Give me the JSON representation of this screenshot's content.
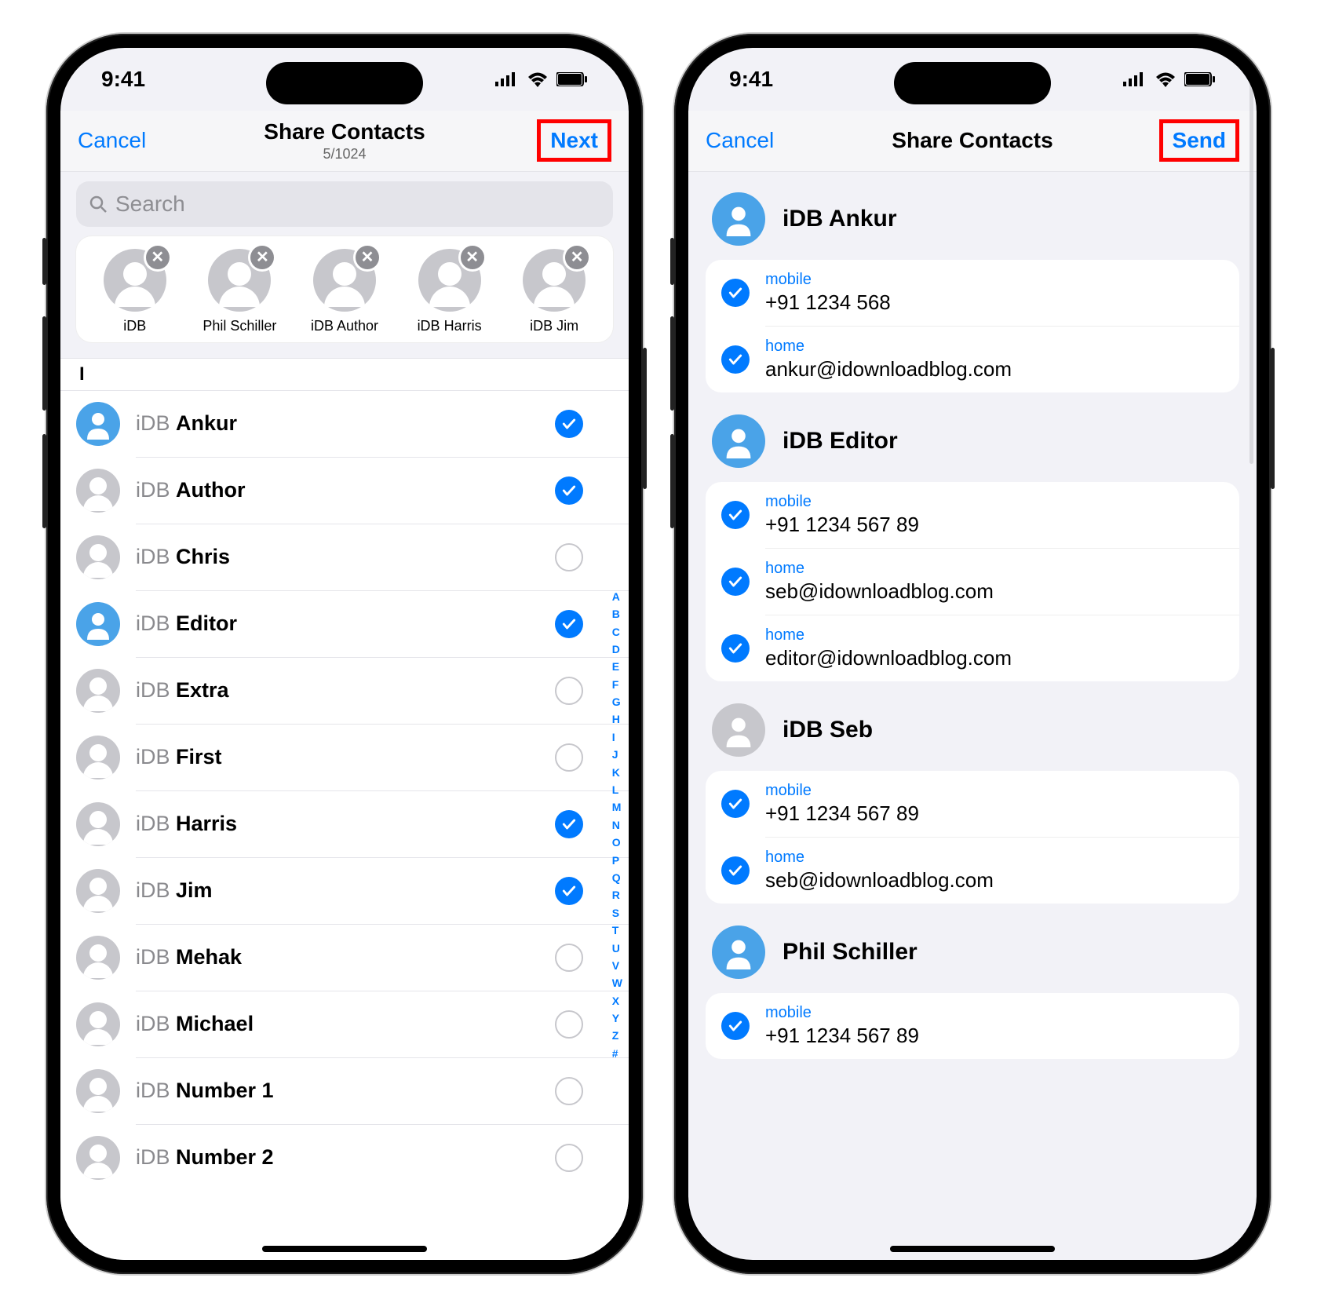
{
  "status_time": "9:41",
  "s1": {
    "cancel": "Cancel",
    "title": "Share Contacts",
    "subtitle": "5/1024",
    "next": "Next",
    "search_placeholder": "Search",
    "chips": [
      {
        "label": "iDB"
      },
      {
        "label": "Phil Schiller"
      },
      {
        "label": "iDB Author"
      },
      {
        "label": "iDB Harris"
      },
      {
        "label": "iDB Jim"
      }
    ],
    "section": "I",
    "rows": [
      {
        "first": "iDB",
        "last": "Ankur",
        "checked": true,
        "photo": true
      },
      {
        "first": "iDB",
        "last": "Author",
        "checked": true,
        "photo": false
      },
      {
        "first": "iDB",
        "last": "Chris",
        "checked": false,
        "photo": false
      },
      {
        "first": "iDB",
        "last": "Editor",
        "checked": true,
        "photo": true
      },
      {
        "first": "iDB",
        "last": "Extra",
        "checked": false,
        "photo": false
      },
      {
        "first": "iDB",
        "last": "First",
        "checked": false,
        "photo": false
      },
      {
        "first": "iDB",
        "last": "Harris",
        "checked": true,
        "photo": false
      },
      {
        "first": "iDB",
        "last": "Jim",
        "checked": true,
        "photo": false
      },
      {
        "first": "iDB",
        "last": "Mehak",
        "checked": false,
        "photo": false
      },
      {
        "first": "iDB",
        "last": "Michael",
        "checked": false,
        "photo": false
      },
      {
        "first": "iDB",
        "last": "Number 1",
        "checked": false,
        "photo": false
      },
      {
        "first": "iDB",
        "last": "Number 2",
        "checked": false,
        "photo": false
      }
    ],
    "az": [
      "A",
      "B",
      "C",
      "D",
      "E",
      "F",
      "G",
      "H",
      "I",
      "J",
      "K",
      "L",
      "M",
      "N",
      "O",
      "P",
      "Q",
      "R",
      "S",
      "T",
      "U",
      "V",
      "W",
      "X",
      "Y",
      "Z",
      "#"
    ]
  },
  "s2": {
    "cancel": "Cancel",
    "title": "Share Contacts",
    "send": "Send",
    "contacts": [
      {
        "name": "iDB Ankur",
        "photo": true,
        "fields": [
          {
            "label": "mobile",
            "value": "+91 1234 568"
          },
          {
            "label": "home",
            "value": "ankur@idownloadblog.com"
          }
        ]
      },
      {
        "name": "iDB Editor",
        "photo": true,
        "fields": [
          {
            "label": "mobile",
            "value": "+91 1234 567 89"
          },
          {
            "label": "home",
            "value": "seb@idownloadblog.com"
          },
          {
            "label": "home",
            "value": "editor@idownloadblog.com"
          }
        ]
      },
      {
        "name": "iDB Seb",
        "photo": false,
        "fields": [
          {
            "label": "mobile",
            "value": "+91 1234 567 89"
          },
          {
            "label": "home",
            "value": "seb@idownloadblog.com"
          }
        ]
      },
      {
        "name": "Phil Schiller",
        "photo": true,
        "fields": [
          {
            "label": "mobile",
            "value": "+91 1234 567 89"
          }
        ]
      }
    ]
  }
}
